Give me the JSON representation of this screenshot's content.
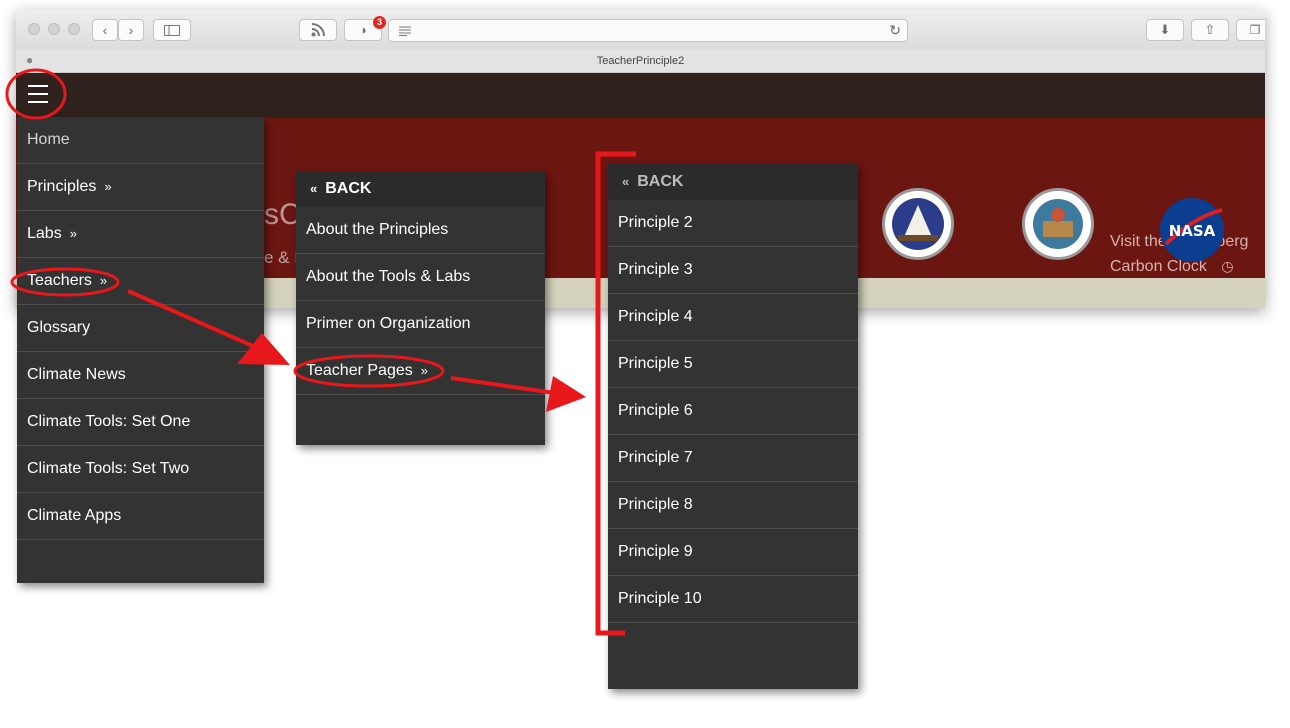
{
  "browser": {
    "tab_title": "TeacherPrinciple2",
    "notification_count": "3",
    "icons": [
      "back-icon",
      "forward-icon",
      "sidebar-icon",
      "rss-icon",
      "ghostery-icon",
      "reader-icon",
      "reload-icon",
      "download-icon",
      "share-icon",
      "tabs-icon",
      "apple-icon"
    ]
  },
  "banner": {
    "title_fragment": "sCa",
    "subtitle_fragment": "e & I",
    "visit_line1": "Visit the Bloomberg",
    "visit_line2": "Carbon Clock",
    "accent_color": "#6c1612",
    "nav_color": "#2f221d"
  },
  "menu1": {
    "items": [
      {
        "label": "Home",
        "has_sub": false
      },
      {
        "label": "Principles",
        "has_sub": true
      },
      {
        "label": "Labs",
        "has_sub": true
      },
      {
        "label": "Teachers",
        "has_sub": true
      },
      {
        "label": "Glossary",
        "has_sub": false
      },
      {
        "label": "Climate News",
        "has_sub": false
      },
      {
        "label": "Climate Tools: Set One",
        "has_sub": false
      },
      {
        "label": "Climate Tools: Set Two",
        "has_sub": false
      },
      {
        "label": "Climate Apps",
        "has_sub": false
      }
    ]
  },
  "menu2": {
    "back_label": "BACK",
    "items": [
      {
        "label": "About the Principles"
      },
      {
        "label": "About the Tools & Labs"
      },
      {
        "label": "Primer on Organization"
      },
      {
        "label": "Teacher Pages"
      }
    ]
  },
  "menu3": {
    "back_label": "BACK",
    "items": [
      {
        "label": "Principle 2"
      },
      {
        "label": "Principle 3"
      },
      {
        "label": "Principle 4"
      },
      {
        "label": "Principle 5"
      },
      {
        "label": "Principle 6"
      },
      {
        "label": "Principle 7"
      },
      {
        "label": "Principle 8"
      },
      {
        "label": "Principle 9"
      },
      {
        "label": "Principle 10"
      }
    ]
  },
  "glyphs": {
    "sub": "»",
    "back": "«"
  },
  "annotation_color": "#e8171b"
}
